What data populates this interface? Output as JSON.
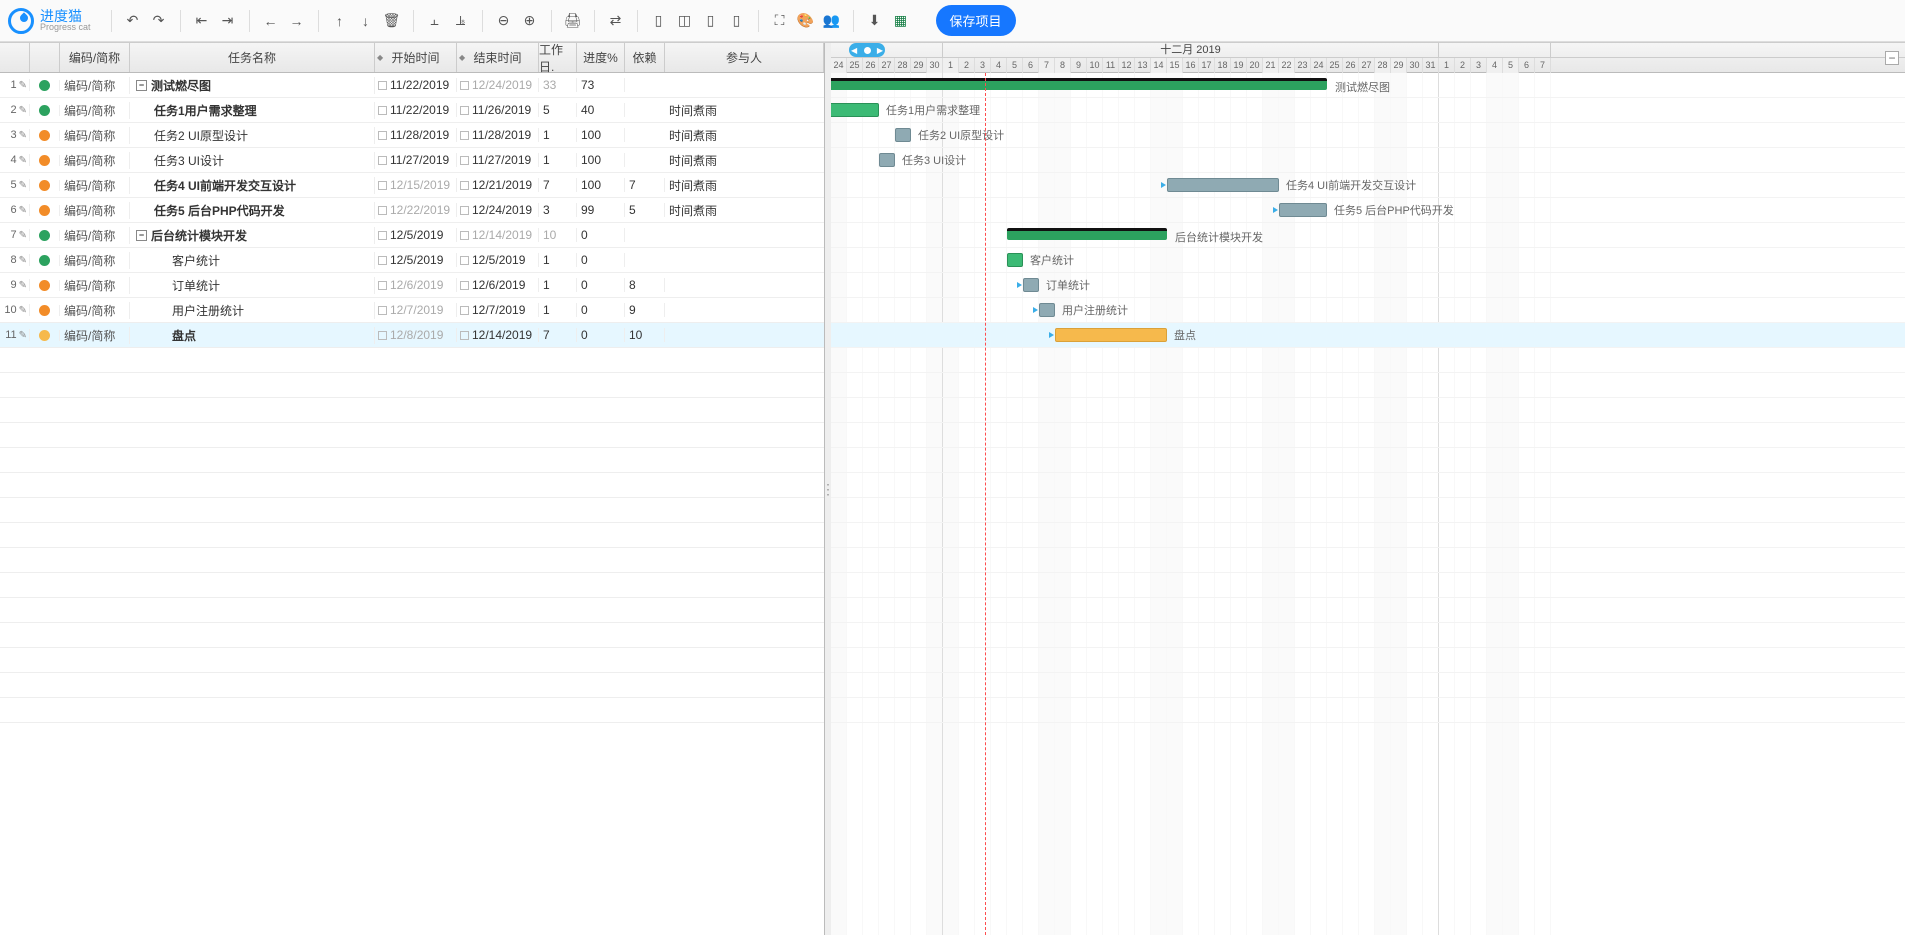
{
  "app": {
    "name_cn": "进度猫",
    "name_en": "Progress cat",
    "save_label": "保存项目"
  },
  "toolbar_icons": [
    "undo",
    "redo",
    "outdent",
    "indent",
    "left",
    "right",
    "up",
    "down",
    "delete",
    "align-top",
    "align-bottom",
    "zoom-out",
    "zoom-in",
    "print",
    "link",
    "col1",
    "col2",
    "col3",
    "col4",
    "fullscreen",
    "palette",
    "users",
    "download",
    "excel"
  ],
  "columns": {
    "code": "编码/简称",
    "name": "任务名称",
    "start": "开始时间",
    "end": "结束时间",
    "days": "工作日.",
    "progress": "进度%",
    "dep": "依赖",
    "people": "参与人"
  },
  "timeline": {
    "month_label": "十二月 2019",
    "nov_start_day": 24,
    "nov_days": 7,
    "dec_days": 31,
    "jan_days": 7,
    "day_width": 16
  },
  "rows": [
    {
      "n": 1,
      "status": "#2ca25f",
      "code": "编码/简称",
      "name": "测试燃尽图",
      "indent": 0,
      "expand": true,
      "bold": true,
      "start": "11/22/2019",
      "start_dim": false,
      "end": "12/24/2019",
      "end_dim": true,
      "days": "33",
      "days_dim": true,
      "prog": "73",
      "dep": "",
      "people": "",
      "bar_start": -2,
      "bar_len": 33,
      "bar_type": "parent",
      "bar_pct": "73%"
    },
    {
      "n": 2,
      "status": "#2ca25f",
      "code": "编码/简称",
      "name": "任务1用户需求整理",
      "indent": 1,
      "bold": true,
      "start": "11/22/2019",
      "end": "11/26/2019",
      "days": "5",
      "prog": "40",
      "dep": "",
      "people": "时间煮雨",
      "bar_start": -2,
      "bar_len": 5,
      "bar_type": "green",
      "bar_prog": 40,
      "bar_pct": "40%"
    },
    {
      "n": 3,
      "status": "#f28c28",
      "code": "编码/简称",
      "name": "任务2 UI原型设计",
      "indent": 1,
      "start": "11/28/2019",
      "end": "11/28/2019",
      "days": "1",
      "prog": "100",
      "dep": "",
      "people": "时间煮雨",
      "bar_start": 4,
      "bar_len": 1,
      "bar_type": "task"
    },
    {
      "n": 4,
      "status": "#f28c28",
      "code": "编码/简称",
      "name": "任务3 UI设计",
      "indent": 1,
      "start": "11/27/2019",
      "end": "11/27/2019",
      "days": "1",
      "prog": "100",
      "dep": "",
      "people": "时间煮雨",
      "bar_start": 3,
      "bar_len": 1,
      "bar_type": "task"
    },
    {
      "n": 5,
      "status": "#f28c28",
      "code": "编码/简称",
      "name": "任务4 UI前端开发交互设计",
      "indent": 1,
      "bold": true,
      "start": "12/15/2019",
      "start_dim": true,
      "end": "12/21/2019",
      "days": "7",
      "prog": "100",
      "dep": "7",
      "people": "时间煮雨",
      "bar_start": 21,
      "bar_len": 7,
      "bar_type": "task"
    },
    {
      "n": 6,
      "status": "#f28c28",
      "code": "编码/简称",
      "name": "任务5 后台PHP代码开发",
      "indent": 1,
      "bold": true,
      "start": "12/22/2019",
      "start_dim": true,
      "end": "12/24/2019",
      "days": "3",
      "prog": "99",
      "dep": "5",
      "people": "时间煮雨",
      "bar_start": 28,
      "bar_len": 3,
      "bar_type": "task"
    },
    {
      "n": 7,
      "status": "#2ca25f",
      "code": "编码/简称",
      "name": "后台统计模块开发",
      "indent": 0,
      "expand": true,
      "bold": true,
      "start": "12/5/2019",
      "end": "12/14/2019",
      "end_dim": true,
      "days": "10",
      "days_dim": true,
      "prog": "0",
      "dep": "",
      "people": "",
      "bar_start": 11,
      "bar_len": 10,
      "bar_type": "parent"
    },
    {
      "n": 8,
      "status": "#2ca25f",
      "code": "编码/简称",
      "name": "客户统计",
      "indent": 2,
      "start": "12/5/2019",
      "end": "12/5/2019",
      "days": "1",
      "prog": "0",
      "dep": "",
      "people": "",
      "bar_start": 11,
      "bar_len": 1,
      "bar_type": "green"
    },
    {
      "n": 9,
      "status": "#f28c28",
      "code": "编码/简称",
      "name": "订单统计",
      "indent": 2,
      "start": "12/6/2019",
      "start_dim": true,
      "end": "12/6/2019",
      "days": "1",
      "prog": "0",
      "dep": "8",
      "people": "",
      "bar_start": 12,
      "bar_len": 1,
      "bar_type": "task"
    },
    {
      "n": 10,
      "status": "#f28c28",
      "code": "编码/简称",
      "name": "用户注册统计",
      "indent": 2,
      "start": "12/7/2019",
      "start_dim": true,
      "end": "12/7/2019",
      "days": "1",
      "prog": "0",
      "dep": "9",
      "people": "",
      "bar_start": 13,
      "bar_len": 1,
      "bar_type": "task"
    },
    {
      "n": 11,
      "status": "#f6b94c",
      "code": "编码/简称",
      "name": "盘点",
      "indent": 2,
      "bold": true,
      "selected": true,
      "start": "12/8/2019",
      "start_dim": true,
      "end": "12/14/2019",
      "days": "7",
      "prog": "0",
      "dep": "10",
      "people": "",
      "bar_start": 14,
      "bar_len": 7,
      "bar_type": "orange"
    }
  ]
}
